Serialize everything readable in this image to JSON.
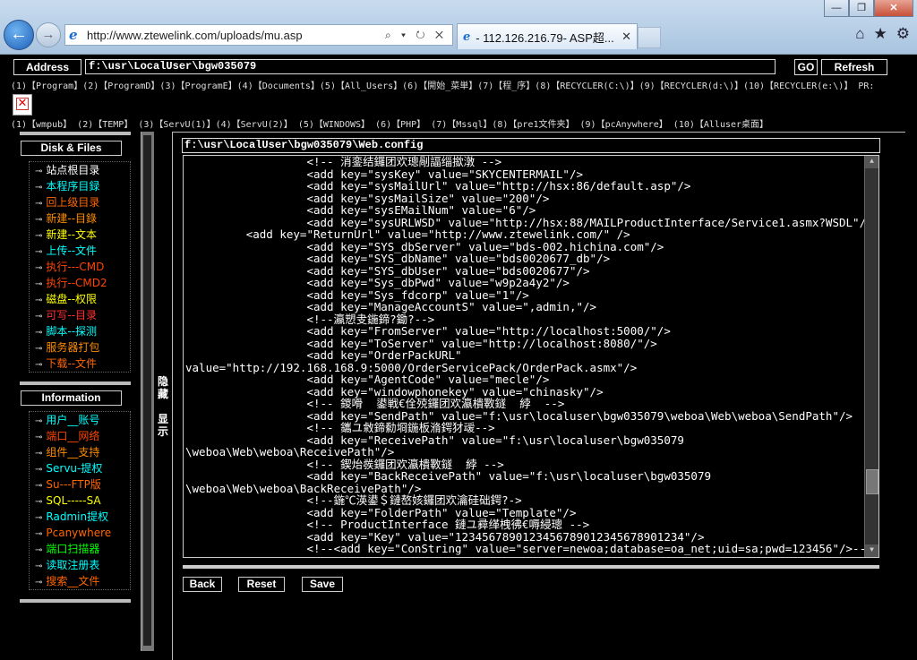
{
  "browser": {
    "url": "http://www.ztewelink.com/uploads/mu.asp",
    "address_tools": "⌕ ▾ ↻ ✕",
    "tab_title": "- 112.126.216.79- ASP超...",
    "tab_close": "✕",
    "window_buttons": [
      "—",
      "❐",
      "✕"
    ],
    "right_icons": [
      "⌂",
      "★",
      "⚙"
    ]
  },
  "toolbar": {
    "address_label": "Address",
    "address_value": "f:\\usr\\LocalUser\\bgw035079",
    "go_label": "GO",
    "refresh_label": "Refresh"
  },
  "drives_row1": "(1)【Program】(2)【ProgramD】(3)【ProgramE】(4)【Documents】(5)【All_Users】(6)【開始_菜単】(7)【程_序】(8)【RECYCLER(C:\\)】(9)【RECYCLER(d:\\)】(10)【RECYCLER(e:\\)】 PR:",
  "drives_row2": "(1)【wmpub】   (2)【TEMP】     (3)【ServU(1)】(4)【ServU(2)】  (5)【WINDOWS】   (6)【PHP】        (7)【Mssql】(8)【pre1文件夹】    (9)【pcAnywhere】 (10)【Alluser桌面】",
  "sidebar": {
    "disk_title": "Disk & Files",
    "disk_items": [
      {
        "label": "站点根目录",
        "color": "#ffffff"
      },
      {
        "label": "本程序目録",
        "color": "#00ffff"
      },
      {
        "label": "回上级目录",
        "color": "#ff6600"
      },
      {
        "label": "新建--目錄",
        "color": "#ff8c00"
      },
      {
        "label": "新建--文本",
        "color": "#ffff00"
      },
      {
        "label": "上传--文件",
        "color": "#00ffff"
      },
      {
        "label": "执行---CMD",
        "color": "#ff4500"
      },
      {
        "label": "执行--CMD2",
        "color": "#ff4500"
      },
      {
        "label": "磁盘--权限",
        "color": "#ffff00"
      },
      {
        "label": "可写--目录",
        "color": "#ff3333"
      },
      {
        "label": "脚本--探测",
        "color": "#00ffff"
      },
      {
        "label": "服务器打包",
        "color": "#ff8c00"
      },
      {
        "label": "下载--文件",
        "color": "#ff6600"
      }
    ],
    "info_title": "Information",
    "info_items": [
      {
        "label": "用户__账号",
        "color": "#00ffff"
      },
      {
        "label": "端口__网络",
        "color": "#ff4500"
      },
      {
        "label": "组件__支持",
        "color": "#ff8c00"
      },
      {
        "label": "Servu-提权",
        "color": "#00ffff"
      },
      {
        "label": "Su---FTP版",
        "color": "#ff6600"
      },
      {
        "label": "SQL-----SA",
        "color": "#ffff00"
      },
      {
        "label": "Radmin提权",
        "color": "#00ffff"
      },
      {
        "label": "Pcanywhere",
        "color": "#ff6600"
      },
      {
        "label": "端口扫描器",
        "color": "#00ff00"
      },
      {
        "label": "读取注册表",
        "color": "#00ffff"
      },
      {
        "label": "搜索__文件",
        "color": "#ff6600"
      }
    ],
    "item_icon": "⊸",
    "hide_label": "隐\n藏",
    "show_label": "显\n示"
  },
  "editor": {
    "path": "f:\\usr\\LocalUser\\bgw035079\\Web.config",
    "lines": [
      "                  <!-- 消銮结鑼团欢璁剮諨缁撳潡 -->",
      "                  <add key=\"sysKey\" value=\"SKYCENTERMAIL\"/>",
      "                  <add key=\"sysMailUrl\" value=\"http://hsx:86/default.asp\"/>",
      "                  <add key=\"sysMailSize\" value=\"200\"/>",
      "                  <add key=\"sysEMailNum\" value=\"6\"/>",
      "                  <add key=\"sysURLWSD\" value=\"http://hsx:88/MAILProductInterface/Service1.asmx?WSDL\"/>",
      "         <add key=\"ReturnUrl\" value=\"http://www.ztewelink.com/\" />",
      "                  <add key=\"SYS_dbServer\" value=\"bds-002.hichina.com\"/>",
      "                  <add key=\"SYS_dbName\" value=\"bds0020677_db\"/>",
      "                  <add key=\"SYS_dbUser\" value=\"bds0020677\"/>",
      "                  <add key=\"Sys_dbPwd\" value=\"w9p2a4y2\"/>",
      "                  <add key=\"Sys_fdcorp\" value=\"1\"/>",
      "                  <add key=\"ManageAccountS\" value=\",admin,\"/>",
      "                  <!--瀛愬叏鍦鍗?鋤?-->",
      "                  <add key=\"FromServer\" value=\"http://localhost:5000/\"/>",
      "                  <add key=\"ToServer\" value=\"http://localhost:8080/\"/>",
      "                  <add key=\"OrderPackURL\"",
      "value=\"http://192.168.168.9:5000/OrderServicePack/OrderPack.asmx\"/>",
      "                  <add key=\"AgentCode\" value=\"mecle\"/>",
      "                  <add key=\"windowphonekey\" value=\"chinasky\"/>",
      "                  <!-- 鍐嗗  鍙戦€佺殑鑼团欢瀛樻斁鐩  綍  -->",
      "                  <add key=\"SendPath\" value=\"f:\\usr\\localuser\\bgw035079\\weboa\\Web\\weboa\\SendPath\"/>",
      "                  <!-- 鑴ユ敹鍗勬埛鍦板潃鍔犲叆-->",
      "                  <add key=\"ReceivePath\" value=\"f:\\usr\\localuser\\bgw035079",
      "\\weboa\\Web\\weboa\\ReceivePath\"/>",
      "                  <!-- 鍥炲彂鑼团欢瀛樻斁鐩  綍 -->",
      "                  <add key=\"BackReceivePath\" value=\"f:\\usr\\localuser\\bgw035079",
      "\\weboa\\Web\\weboa\\BackReceivePath\"/>",
      "                  <!--鍦℃渶鍙＄鏈嶅姟鑼团欢瀹硅础鍔?->",
      "                  <add key=\"FolderPath\" value=\"Template\"/>",
      "                  <!-- ProductInterface 鏈ユ彛缂栧彿€嗕綅璁 -->",
      "                  <add key=\"Key\" value=\"1234567890123456789012345678901234\"/>",
      "                  <!--<add key=\"ConString\" value=\"server=newoa;database=oa_net;uid=sa;pwd=123456\"/>-->"
    ],
    "back_label": "Back",
    "reset_label": "Reset",
    "save_label": "Save"
  }
}
